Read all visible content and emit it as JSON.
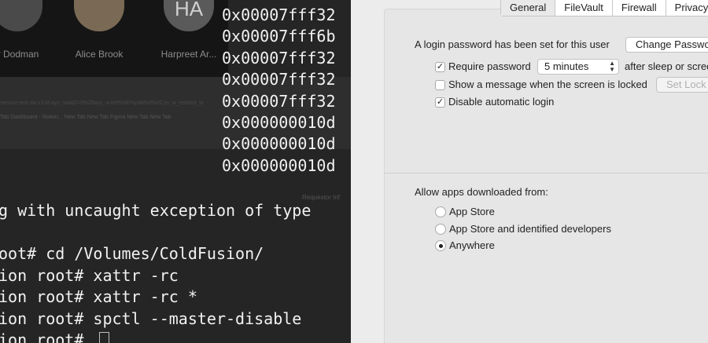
{
  "background": {
    "participants": [
      {
        "name": "y Dodman",
        "initials": ""
      },
      {
        "name": "Alice Brook",
        "initials": ""
      },
      {
        "name": "Harpreet Ar...",
        "initials": "HA"
      }
    ],
    "ghost_url": "service-test.sw.s3.bf.ays_sidaD=3%28ays_w.ket%3D%jnld%3%2Cys_w_related_st",
    "ghost_tabs": "Tab  Dashboard - Notion...  New Tab  New Tab  Figma  New Tab  New Tab",
    "ghost_label": "Requestor Inf"
  },
  "terminal": {
    "hex_lines": [
      "0x00007fff32",
      "0x00007fff6b",
      "0x00007fff32",
      "0x00007fff32",
      "0x00007fff32",
      "0x000000010d",
      "0x000000010d",
      "0x000000010d"
    ],
    "lines": [
      "g with uncaught exception of type",
      "",
      "oot# cd /Volumes/ColdFusion/",
      "ion root# xattr -rc",
      "ion root# xattr -rc *",
      "ion root# spctl --master-disable",
      "ion root# "
    ]
  },
  "panel": {
    "tabs": [
      "General",
      "FileVault",
      "Firewall",
      "Privacy"
    ],
    "active_tab": "General",
    "login_text": "A login password has been set for this user",
    "change_password_button": "Change Password...",
    "require_password_label": "Require password",
    "require_password_checked": true,
    "require_password_delay": "5 minutes",
    "after_sleep_text": "after sleep or screen saver begins",
    "show_message_label": "Show a message when the screen is locked",
    "show_message_checked": false,
    "set_lock_button": "Set Lock Message...",
    "disable_autologin_label": "Disable automatic login",
    "disable_autologin_checked": true,
    "allow_apps_label": "Allow apps downloaded from:",
    "radio_options": [
      "App Store",
      "App Store and identified developers",
      "Anywhere"
    ],
    "radio_selected": "Anywhere"
  },
  "colors": {
    "terminal_bg": "#252525",
    "terminal_text": "#f2f2f2",
    "panel_bg": "#ececec"
  },
  "icons": {
    "checkmark": "checkmark-icon",
    "stepper": "stepper-arrows-icon"
  }
}
